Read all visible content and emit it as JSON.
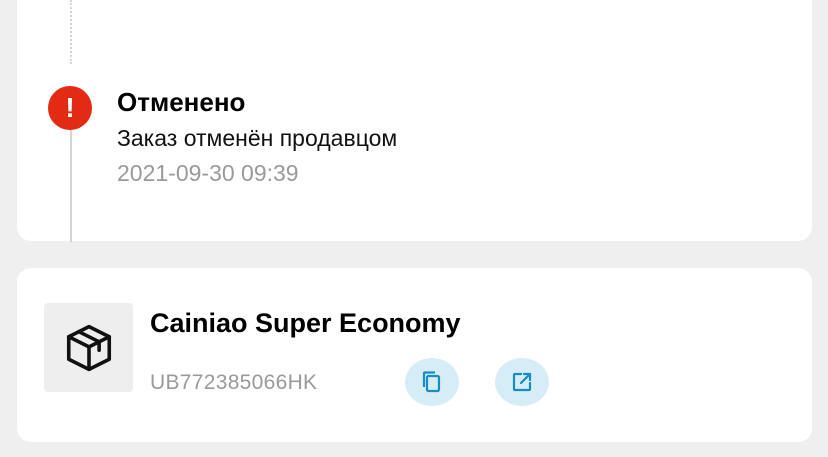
{
  "status": {
    "icon": "exclamation-icon",
    "icon_glyph": "!",
    "title": "Отменено",
    "description": "Заказ отменён продавцом",
    "timestamp": "2021-09-30 09:39",
    "accent_color": "#e32a12"
  },
  "shipping": {
    "thumbnail_icon": "package-box-icon",
    "carrier": "Cainiao Super Economy",
    "tracking_number": "UB772385066HK",
    "actions": [
      {
        "name": "copy-tracking-button",
        "icon": "copy-icon"
      },
      {
        "name": "open-tracking-button",
        "icon": "external-link-icon"
      }
    ],
    "action_color": "#1a8cc4",
    "action_bg": "#d6ecf6"
  }
}
